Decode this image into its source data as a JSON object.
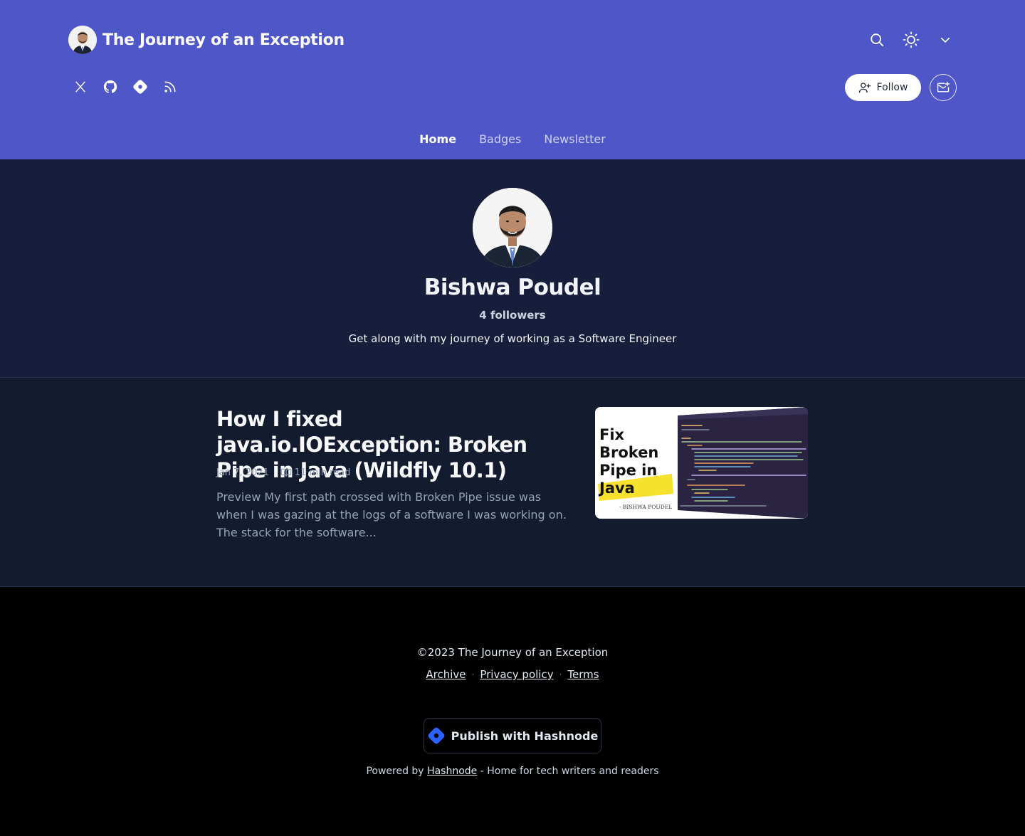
{
  "header": {
    "title": "The Journey of an Exception",
    "follow_label": "Follow",
    "bg": "#4f56c8",
    "actions": [
      {
        "name": "search-icon"
      },
      {
        "name": "sun-icon"
      },
      {
        "name": "chevron-down-icon"
      }
    ],
    "socials": [
      {
        "name": "x-twitter-icon"
      },
      {
        "name": "github-icon"
      },
      {
        "name": "hashnode-icon"
      },
      {
        "name": "rss-icon"
      }
    ]
  },
  "nav": {
    "items": [
      {
        "label": "Home",
        "active": true
      },
      {
        "label": "Badges",
        "active": false
      },
      {
        "label": "Newsletter",
        "active": false
      }
    ]
  },
  "profile": {
    "name": "Bishwa Poudel",
    "followers": "4 followers",
    "bio": "Get along with my journey of working as a Software Engineer"
  },
  "post": {
    "title": "How I fixed java.io.IOException: Broken Pipe in Java (Wildfly 10.1)",
    "date": "Jan 7, 2021",
    "read_time": "11 min read",
    "excerpt": "Preview My first path crossed with Broken Pipe issue was when I was gazing at the logs of a software I was working on. The stack for the software...",
    "cover": {
      "line1": "Fix",
      "line2": "Broken",
      "line3": "Pipe in",
      "line4": "Java",
      "author": "- BISHWA POUDEL",
      "accent": "#f7e12f"
    }
  },
  "footer": {
    "copyright": "©2023 The Journey of an Exception",
    "links": [
      "Archive",
      "Privacy policy",
      "Terms"
    ],
    "separator": "·",
    "publish_label": "Publish with Hashnode",
    "powered_prefix": "Powered by",
    "powered_link": "Hashnode",
    "powered_suffix": "- Home for tech writers and readers"
  }
}
